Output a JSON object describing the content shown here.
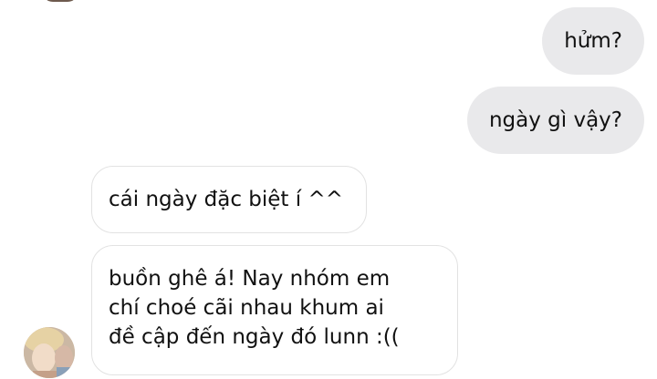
{
  "messages": [
    {
      "direction": "outgoing",
      "text": "hửm?"
    },
    {
      "direction": "outgoing",
      "text": "ngày gì vậy?"
    },
    {
      "direction": "incoming",
      "text": "cái ngày đặc biệt í ^^"
    },
    {
      "direction": "incoming",
      "lines": [
        "buồn ghê á! Nay nhóm em",
        "chí choé cãi nhau khum ai",
        "đề cập đến ngày đó lunn :(("
      ]
    }
  ],
  "colors": {
    "outgoing_bubble": "#e9e9eb",
    "incoming_border": "#e2e2e2",
    "text": "#111111"
  },
  "icons": {
    "contact_avatar": "contact-avatar-photo"
  }
}
